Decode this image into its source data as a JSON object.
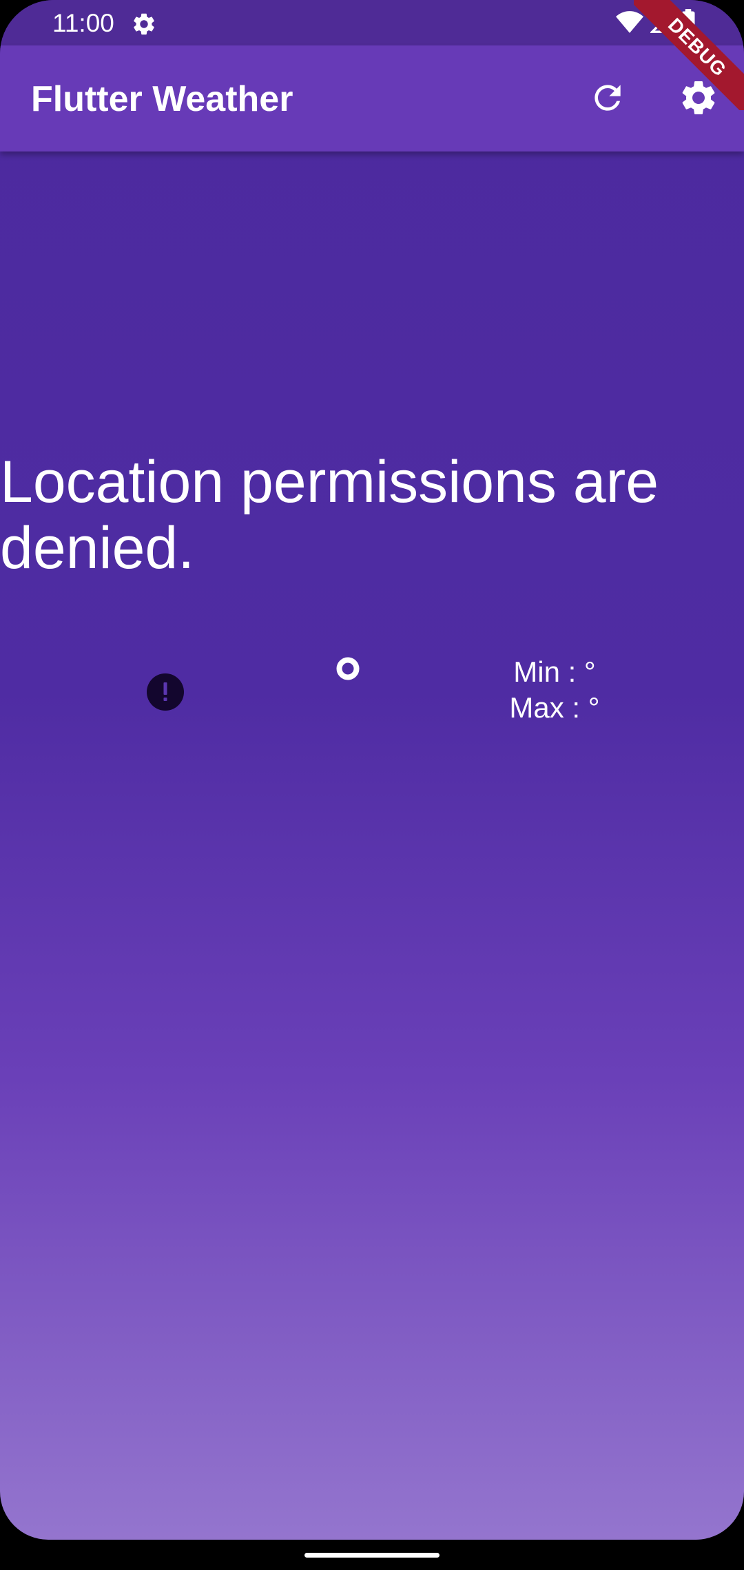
{
  "status_bar": {
    "time": "11:00",
    "icons": [
      "settings-icon",
      "wifi-icon",
      "signal-icon",
      "battery-icon"
    ]
  },
  "app_bar": {
    "title": "Flutter Weather",
    "actions": [
      "refresh-icon",
      "settings-icon"
    ]
  },
  "debug_banner": {
    "label": "DEBUG"
  },
  "main": {
    "message": "Location permissions are denied.",
    "weather_icon": "error-icon",
    "temperature_icon": "degree-circle-icon",
    "min_label": "Min : °",
    "max_label": "Max : °"
  },
  "colors": {
    "status_bar": "#4f2b96",
    "app_bar": "#673ab7",
    "background_top": "#4c2a9e",
    "background_bottom": "#9475ce",
    "debug_banner": "#a3182e"
  }
}
